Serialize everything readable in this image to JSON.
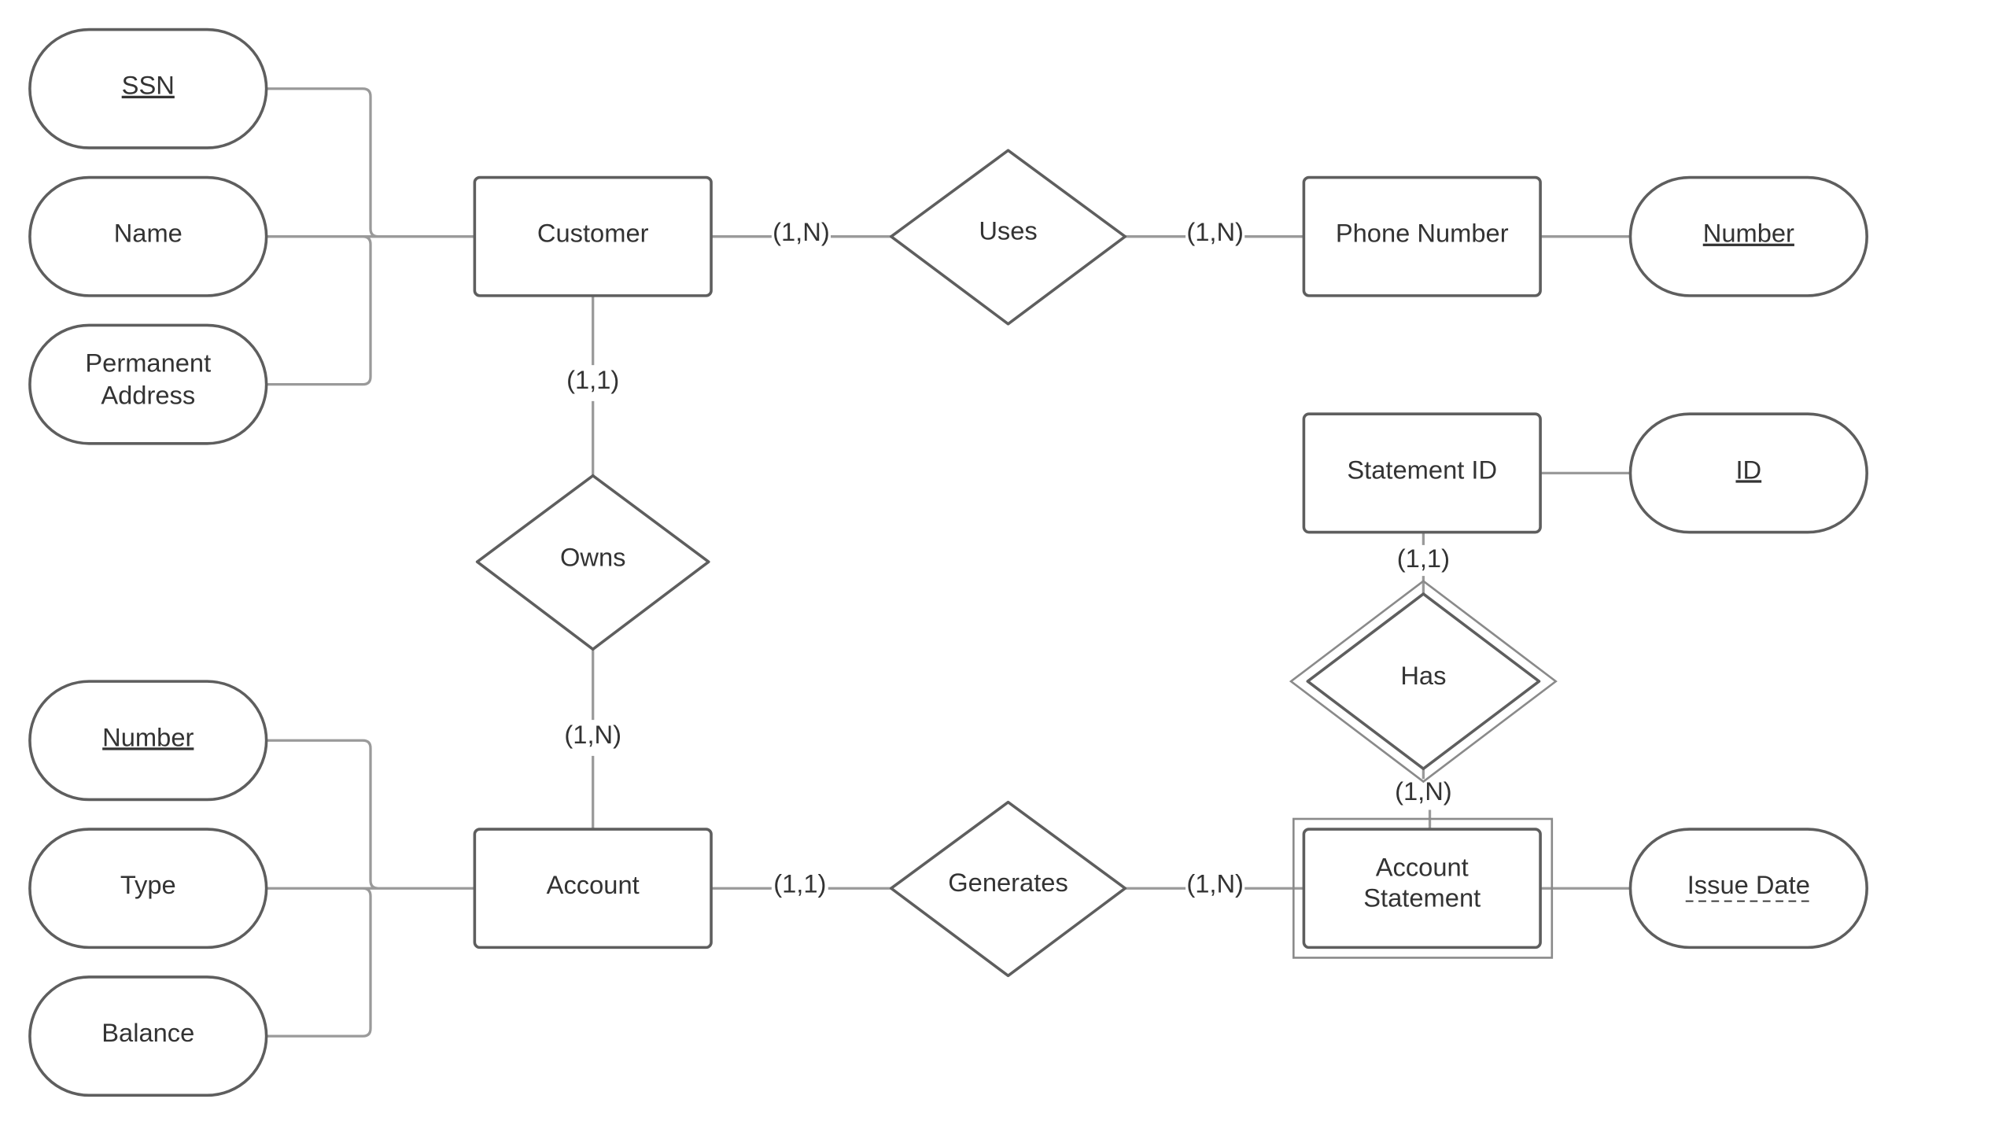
{
  "diagram_type": "Entity-Relationship",
  "colors": {
    "shape_stroke": "#5e5e5e",
    "connector": "#9a9a9a",
    "text": "#333333",
    "background": "#ffffff"
  },
  "entities": {
    "customer": {
      "label": "Customer",
      "weak": false
    },
    "phone_number": {
      "label": "Phone Number",
      "weak": false
    },
    "statement_id": {
      "label": "Statement ID",
      "weak": false
    },
    "account": {
      "label": "Account",
      "weak": false
    },
    "account_statement": {
      "label_lines": [
        "Account",
        "Statement"
      ],
      "weak": true
    }
  },
  "relationships": {
    "uses": {
      "label": "Uses",
      "identifying": false
    },
    "owns": {
      "label": "Owns",
      "identifying": false
    },
    "generates": {
      "label": "Generates",
      "identifying": false
    },
    "has": {
      "label": "Has",
      "identifying": true
    }
  },
  "attributes": {
    "ssn": {
      "label": "SSN",
      "key": "primary"
    },
    "name": {
      "label": "Name",
      "key": "none"
    },
    "permanent_address": {
      "label_lines": [
        "Permanent",
        "Address"
      ],
      "key": "none"
    },
    "account_number": {
      "label": "Number",
      "key": "primary"
    },
    "type": {
      "label": "Type",
      "key": "none"
    },
    "balance": {
      "label": "Balance",
      "key": "none"
    },
    "phone_number": {
      "label": "Number",
      "key": "primary"
    },
    "id": {
      "label": "ID",
      "key": "primary"
    },
    "issue_date": {
      "label": "Issue Date",
      "key": "partial"
    }
  },
  "cardinalities": {
    "customer_uses": "(1,N)",
    "uses_phone": "(1,N)",
    "customer_owns": "(1,1)",
    "owns_account": "(1,N)",
    "account_generates": "(1,1)",
    "generates_statement": "(1,N)",
    "statementid_has": "(1,1)",
    "has_statement": "(1,N)"
  }
}
